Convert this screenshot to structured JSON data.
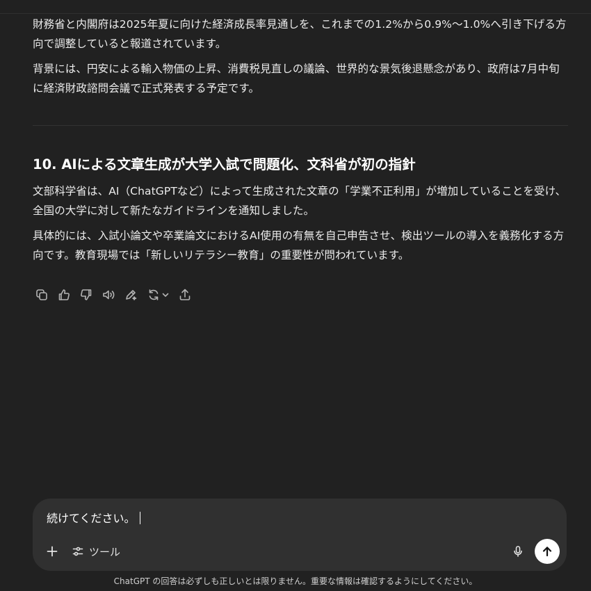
{
  "messages": {
    "p1": "財務省と内閣府は2025年夏に向けた経済成長率見通しを、これまでの1.2%から0.9%〜1.0%へ引き下げる方向で調整していると報道されています。",
    "p2": "背景には、円安による輸入物価の上昇、消費税見直しの議論、世界的な景気後退懸念があり、政府は7月中旬に経済財政諮問会議で正式発表する予定です。",
    "heading": "10. AIによる文章生成が大学入試で問題化、文科省が初の指針",
    "p3": "文部科学省は、AI（ChatGPTなど）によって生成された文章の「学業不正利用」が増加していることを受け、全国の大学に対して新たなガイドラインを通知しました。",
    "p4": "具体的には、入試小論文や卒業論文におけるAI使用の有無を自己申告させ、検出ツールの導入を義務化する方向です。教育現場では「新しいリテラシー教育」の重要性が問われています。"
  },
  "actions": {
    "icons": [
      "copy-icon",
      "thumbs-up-icon",
      "thumbs-down-icon",
      "read-aloud-icon",
      "edit-icon",
      "regenerate-icon",
      "share-icon"
    ]
  },
  "composer": {
    "value": "続けてください。",
    "tools_label": "ツール"
  },
  "footer": {
    "disclaimer": "ChatGPT の回答は必ずしも正しいとは限りません。重要な情報は確認するようにしてください。"
  },
  "colors": {
    "background": "#212121",
    "composer": "#303030",
    "text": "#ececec",
    "send_button": "#ffffff"
  }
}
